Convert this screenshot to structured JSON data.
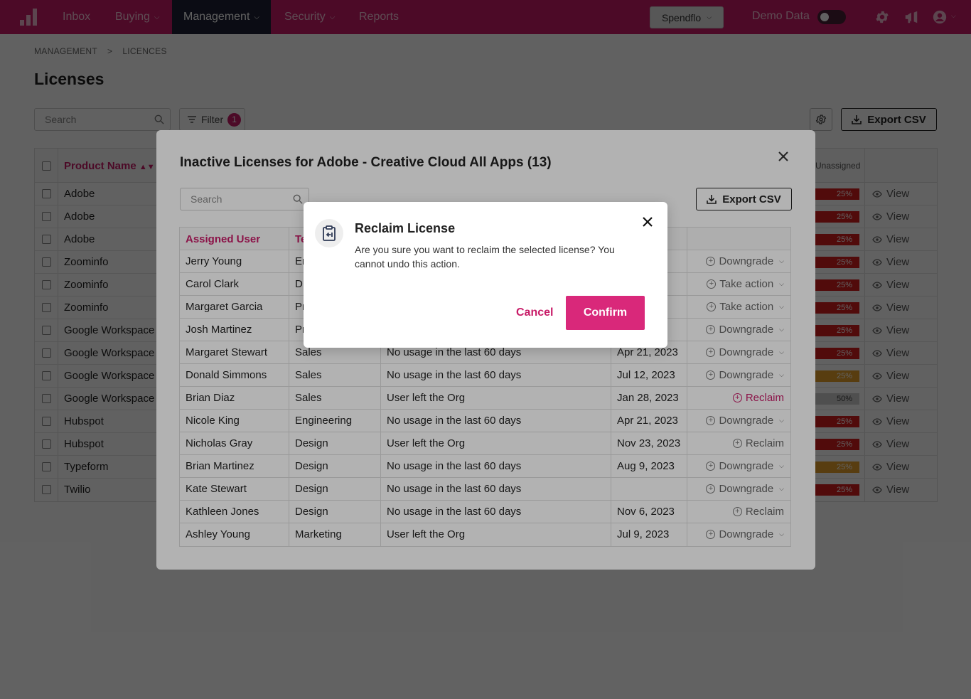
{
  "nav": {
    "items": [
      {
        "label": "Inbox",
        "has_menu": false
      },
      {
        "label": "Buying",
        "has_menu": true
      },
      {
        "label": "Management",
        "has_menu": true,
        "active": true
      },
      {
        "label": "Security",
        "has_menu": true
      },
      {
        "label": "Reports",
        "has_menu": false
      }
    ],
    "org_switcher": "Spendflo",
    "demo_label": "Demo Data",
    "icons": [
      "settings-icon",
      "announcement-icon",
      "user-account-icon"
    ]
  },
  "breadcrumb": [
    "MANAGEMENT",
    "LICENCES"
  ],
  "page_title": "Licenses",
  "toolbar": {
    "search_placeholder": "Search",
    "filter_label": "Filter",
    "filter_count": "1",
    "export_label": "Export CSV"
  },
  "main_table": {
    "header_product": "Product Name",
    "header_unassigned": "Unassigned",
    "view_label": "View",
    "rows": [
      {
        "product": "Adobe",
        "unassigned": "25%",
        "color": "#d42020"
      },
      {
        "product": "Adobe",
        "unassigned": "25%",
        "color": "#d42020"
      },
      {
        "product": "Adobe",
        "unassigned": "25%",
        "color": "#d42020"
      },
      {
        "product": "Zoominfo",
        "unassigned": "25%",
        "color": "#d42020"
      },
      {
        "product": "Zoominfo",
        "unassigned": "25%",
        "color": "#d42020"
      },
      {
        "product": "Zoominfo",
        "unassigned": "25%",
        "color": "#d42020"
      },
      {
        "product": "Google Workspace",
        "unassigned": "25%",
        "color": "#d42020"
      },
      {
        "product": "Google Workspace",
        "unassigned": "25%",
        "color": "#d42020"
      },
      {
        "product": "Google Workspace",
        "unassigned": "25%",
        "color": "#e8a02a"
      },
      {
        "product": "Google Workspace",
        "unassigned": "50%",
        "color": "#cfcfcf"
      },
      {
        "product": "Hubspot",
        "unassigned": "25%",
        "color": "#d42020"
      },
      {
        "product": "Hubspot",
        "unassigned": "25%",
        "color": "#d42020"
      },
      {
        "product": "Typeform",
        "unassigned": "25%",
        "color": "#e8a02a"
      },
      {
        "product": "Twilio",
        "unassigned": "25%",
        "color": "#d42020"
      }
    ]
  },
  "inactive_modal": {
    "title": "Inactive Licenses for Adobe - Creative Cloud All Apps (13)",
    "search_placeholder": "Search",
    "export_label": "Export CSV",
    "headers": {
      "user": "Assigned User",
      "team": "Te"
    },
    "rows": [
      {
        "user": "Jerry Young",
        "team": "En",
        "reason": "",
        "date": "3",
        "action": "Downgrade",
        "menu": true
      },
      {
        "user": "Carol Clark",
        "team": "D",
        "reason": "",
        "date": "",
        "action": "Take action",
        "menu": true
      },
      {
        "user": "Margaret Garcia",
        "team": "Pr",
        "reason": "",
        "date": "",
        "action": "Take action",
        "menu": true
      },
      {
        "user": "Josh Martinez",
        "team": "Pr",
        "reason": "",
        "date": "3",
        "action": "Downgrade",
        "menu": true
      },
      {
        "user": "Margaret Stewart",
        "team": "Sales",
        "reason": "No usage in the last 60 days",
        "date": "Apr 21, 2023",
        "action": "Downgrade",
        "menu": true
      },
      {
        "user": "Donald Simmons",
        "team": "Sales",
        "reason": "No usage in the last 60 days",
        "date": "Jul 12, 2023",
        "action": "Downgrade",
        "menu": true
      },
      {
        "user": "Brian Diaz",
        "team": "Sales",
        "reason": "User left the Org",
        "date": "Jan 28, 2023",
        "action": "Reclaim",
        "menu": false,
        "highlight": true
      },
      {
        "user": "Nicole King",
        "team": "Engineering",
        "reason": "No usage in the last 60 days",
        "date": "Apr 21, 2023",
        "action": "Downgrade",
        "menu": true
      },
      {
        "user": "Nicholas Gray",
        "team": "Design",
        "reason": "User left the Org",
        "date": "Nov 23, 2023",
        "action": "Reclaim",
        "menu": false
      },
      {
        "user": "Brian Martinez",
        "team": "Design",
        "reason": "No usage in the last 60 days",
        "date": "Aug 9, 2023",
        "action": "Downgrade",
        "menu": true
      },
      {
        "user": "Kate Stewart",
        "team": "Design",
        "reason": "No usage in the last 60 days",
        "date": "",
        "action": "Downgrade",
        "menu": true
      },
      {
        "user": "Kathleen Jones",
        "team": "Design",
        "reason": "No usage in the last 60 days",
        "date": "Nov 6, 2023",
        "action": "Reclaim",
        "menu": false
      },
      {
        "user": "Ashley Young",
        "team": "Marketing",
        "reason": "User left the Org",
        "date": "Jul 9, 2023",
        "action": "Downgrade",
        "menu": true
      }
    ]
  },
  "dialog": {
    "icon": "reclaim-clipboard-icon",
    "title": "Reclaim License",
    "message": "Are you sure you want to reclaim the selected license? You cannot undo this action.",
    "cancel_label": "Cancel",
    "confirm_label": "Confirm"
  },
  "colors": {
    "brand": "#c81c68",
    "nav_active": "#1f2235",
    "confirm": "#d9287a"
  }
}
